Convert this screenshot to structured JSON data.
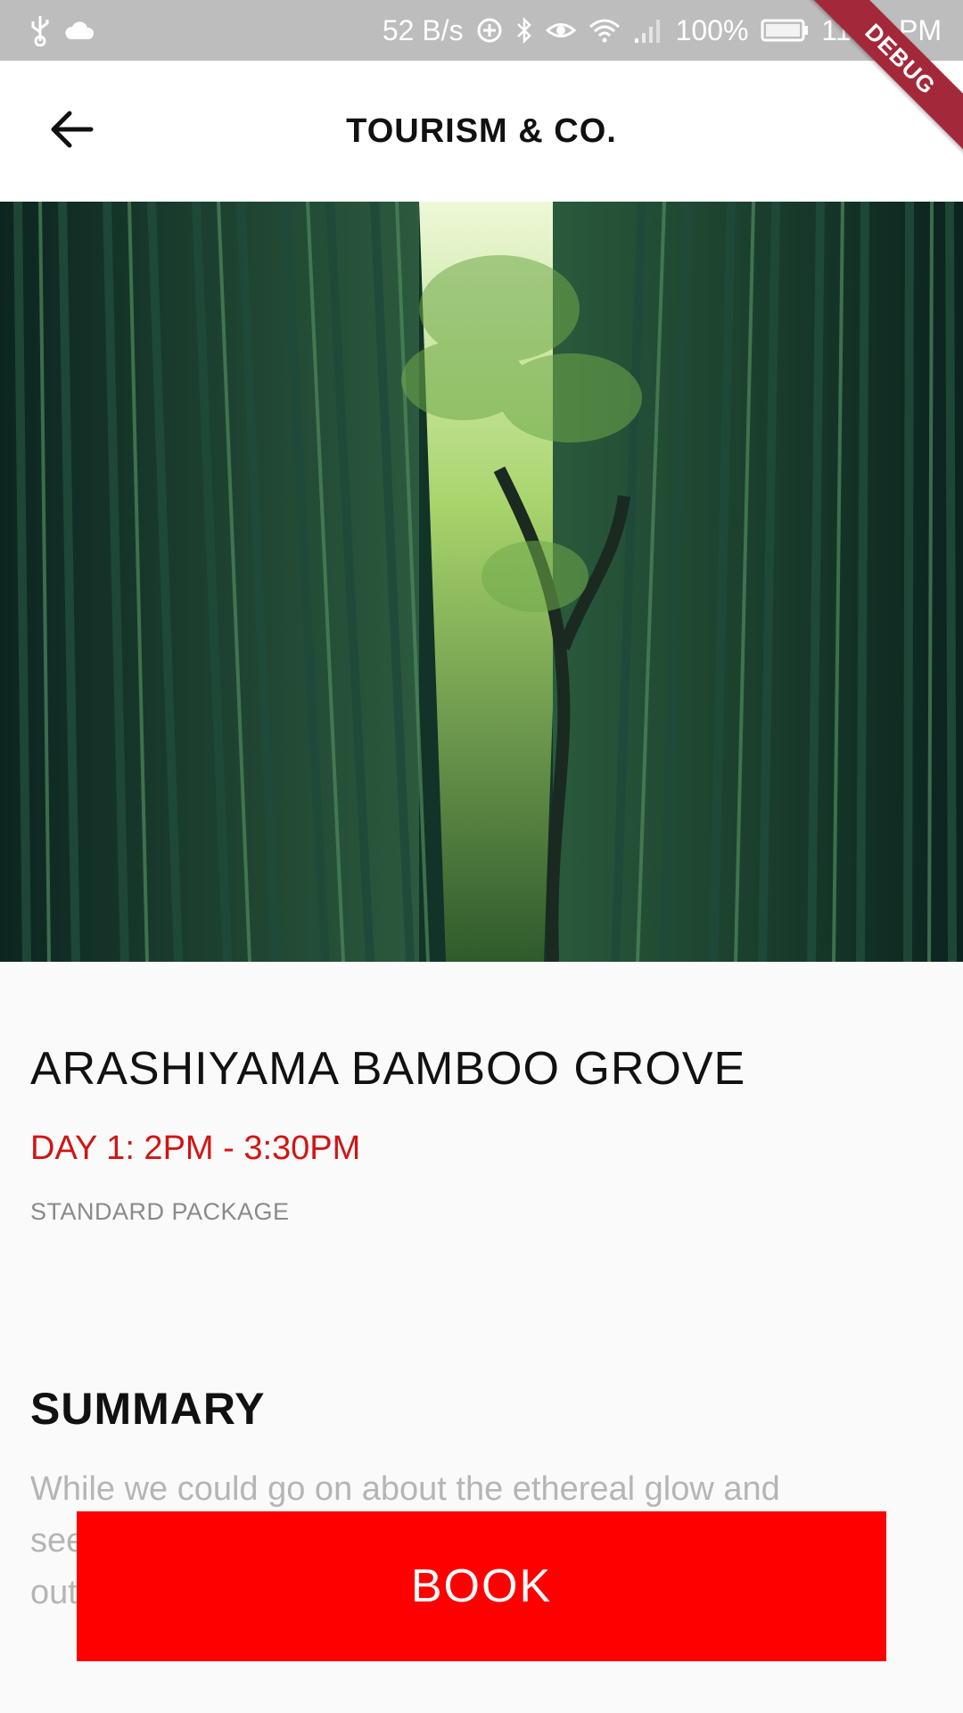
{
  "status_bar": {
    "network_speed": "52 B/s",
    "battery": "100%",
    "time": "11:19 PM",
    "icons": [
      "usb-icon",
      "cloud-icon",
      "data-saver-icon",
      "bluetooth-icon",
      "eye-icon",
      "wifi-icon",
      "signal-icon",
      "battery-icon"
    ]
  },
  "debug_banner": "DEBUG",
  "app_bar": {
    "title": "TOURISM & CO.",
    "back_icon": "arrow-back-icon"
  },
  "hero": {
    "subject": "bamboo-forest-photo"
  },
  "details": {
    "title": "ARASHIYAMA BAMBOO GROVE",
    "time_slot": "DAY 1: 2PM - 3:30PM",
    "package": "STANDARD PACKAGE"
  },
  "summary": {
    "heading": "SUMMARY",
    "text": "While we could go on about the ethereal glow and seemingly endless heights of this bamboo grove on the outskirts of Kyoto, the sight's pleasures extend beyond"
  },
  "book_button": {
    "label": "BOOK"
  },
  "colors": {
    "accent": "#ff0000",
    "time_slot": "#d01515",
    "status_bar": "#bdbdbd"
  }
}
